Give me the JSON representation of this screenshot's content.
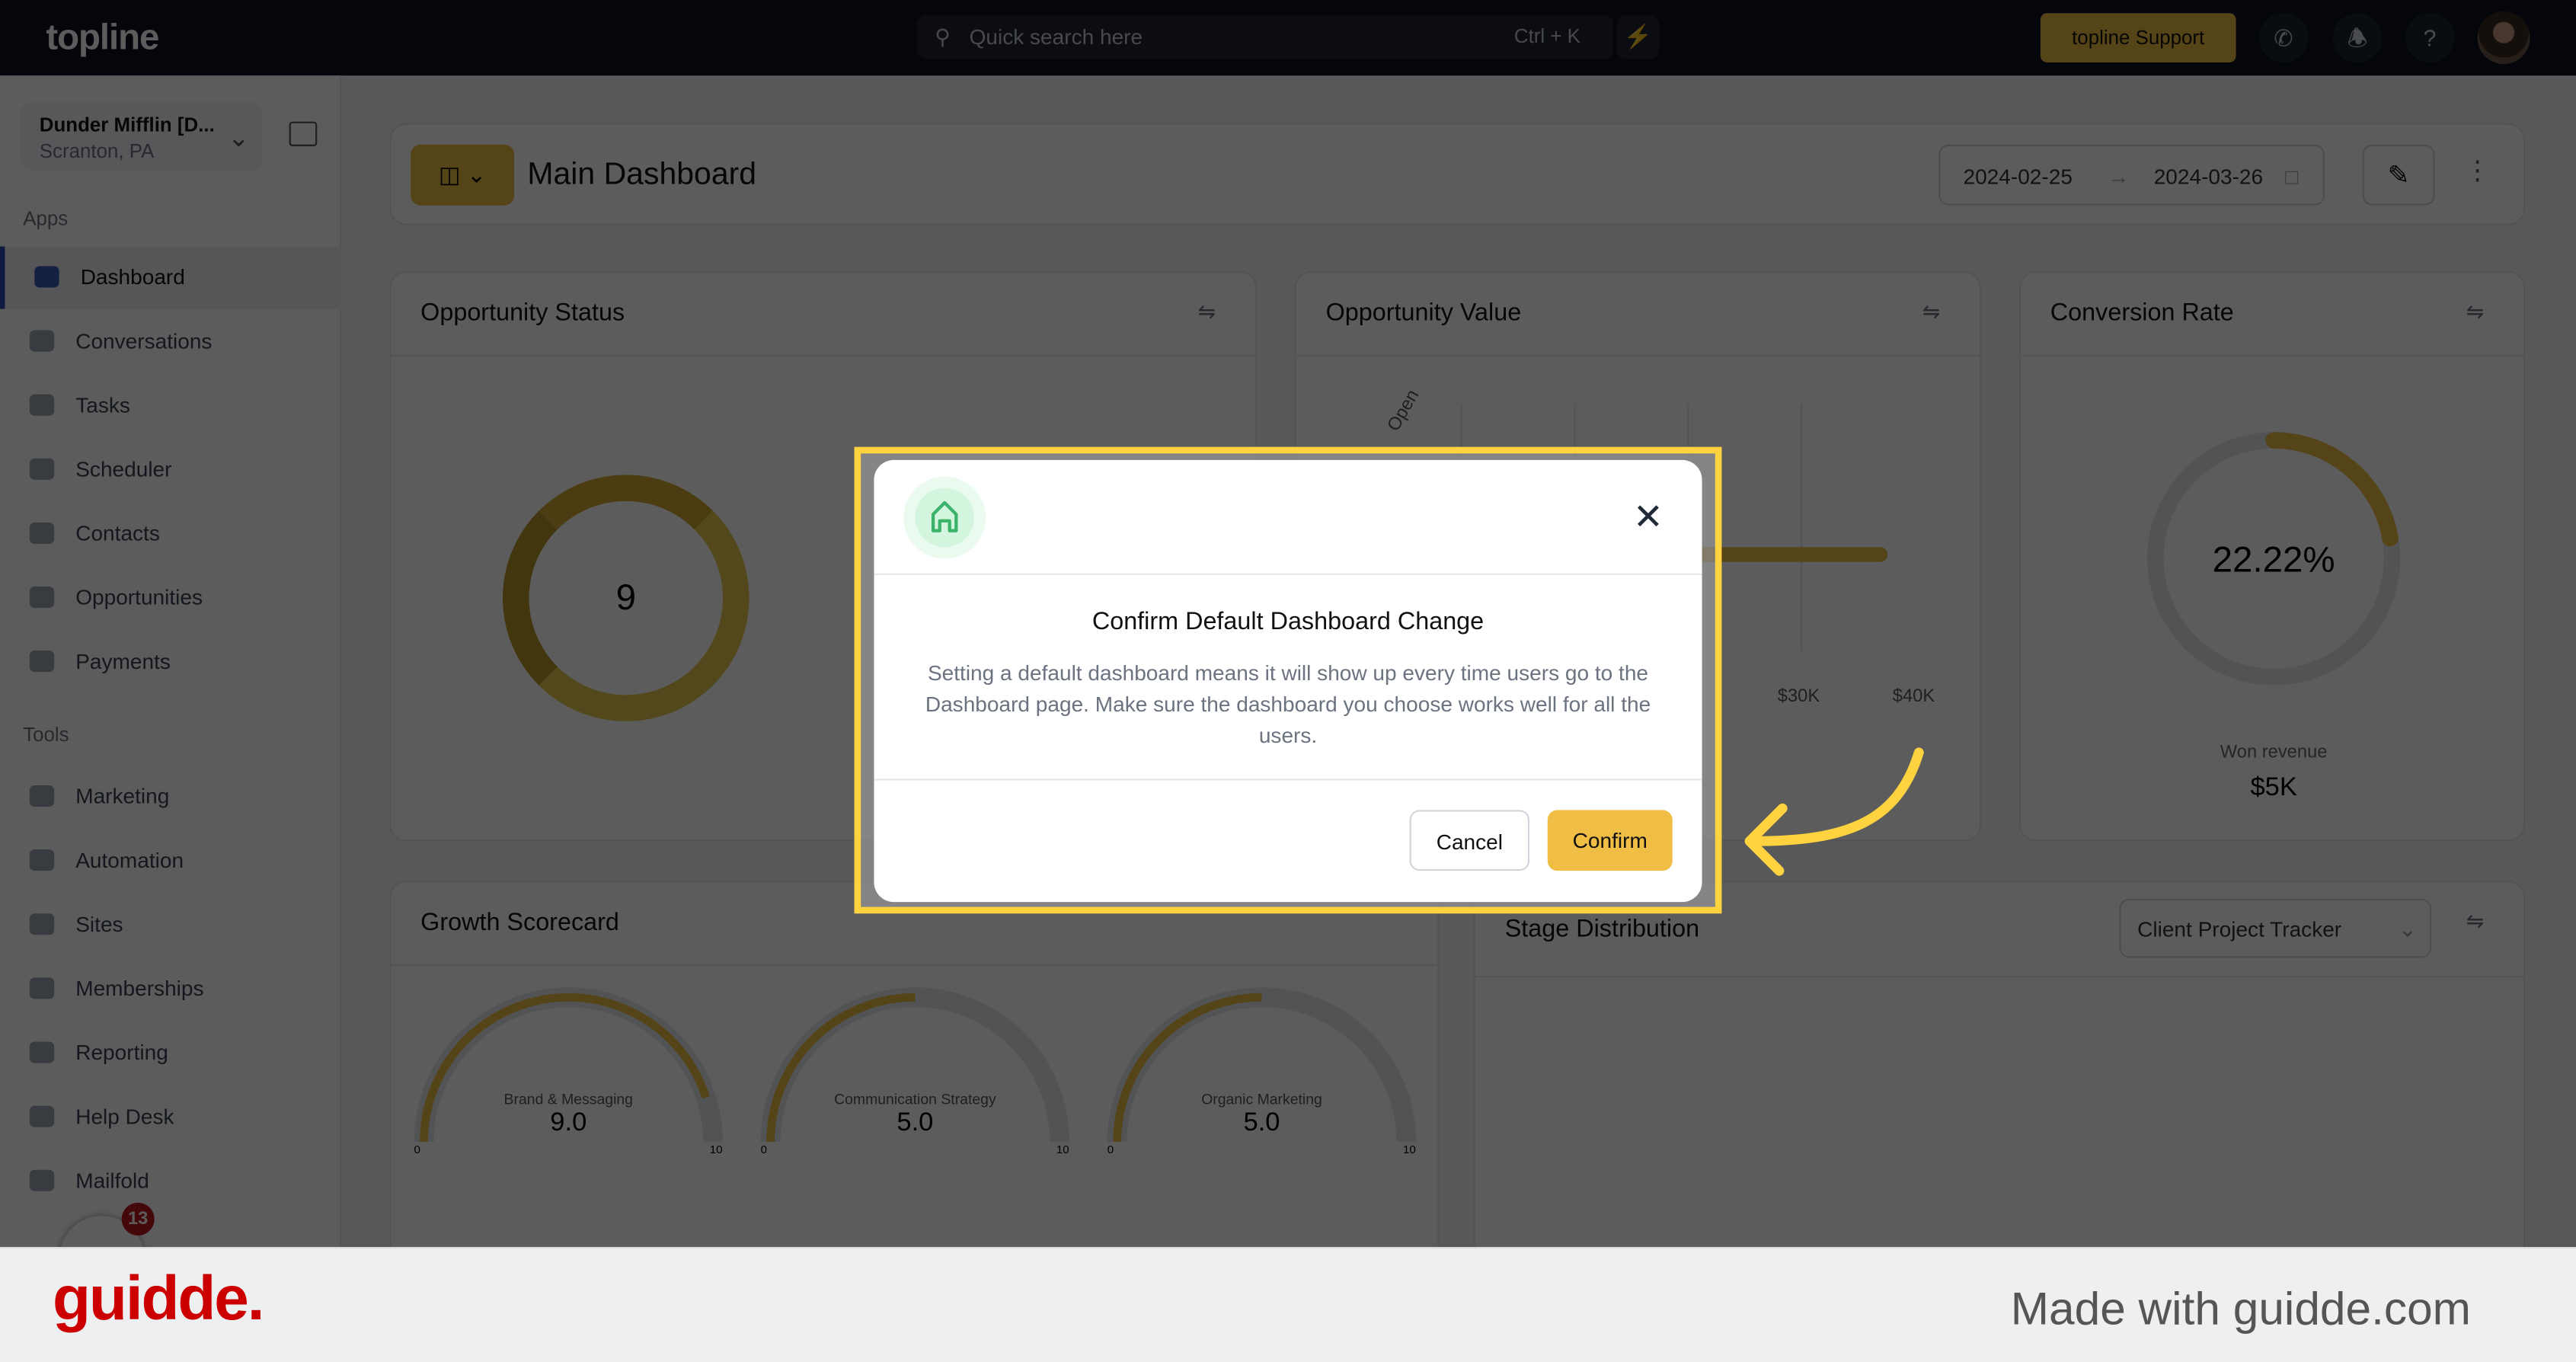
{
  "topbar": {
    "logo": "topline",
    "search_placeholder": "Quick search here",
    "search_shortcut": "Ctrl + K",
    "support_label": "topline Support",
    "icons": [
      "search-icon",
      "bolt-icon",
      "phone-icon",
      "bell-icon",
      "help-icon",
      "avatar"
    ]
  },
  "sidebar": {
    "account_name": "Dunder Mifflin [D...",
    "account_location": "Scranton, PA",
    "apps_label": "Apps",
    "apps": [
      {
        "label": "Dashboard",
        "active": true
      },
      {
        "label": "Conversations"
      },
      {
        "label": "Tasks"
      },
      {
        "label": "Scheduler"
      },
      {
        "label": "Contacts"
      },
      {
        "label": "Opportunities"
      },
      {
        "label": "Payments"
      }
    ],
    "tools_label": "Tools",
    "tools": [
      {
        "label": "Marketing"
      },
      {
        "label": "Automation"
      },
      {
        "label": "Sites"
      },
      {
        "label": "Memberships"
      },
      {
        "label": "Reporting"
      },
      {
        "label": "Help Desk"
      },
      {
        "label": "Mailfold"
      }
    ],
    "badge_count": "13"
  },
  "header": {
    "title": "Main Dashboard",
    "date_start": "2024-02-25",
    "date_end": "2024-03-26"
  },
  "widgets": {
    "opportunity_status": {
      "title": "Opportunity Status",
      "total": "9"
    },
    "opportunity_value": {
      "title": "Opportunity Value",
      "axis_label": "Open",
      "ticks": [
        "$30K",
        "$40K"
      ]
    },
    "conversion_rate": {
      "title": "Conversion Rate",
      "value": "22.22%",
      "fraction": 0.2222,
      "sub_label": "Won revenue",
      "sub_value": "$5K"
    },
    "growth_scorecard": {
      "title": "Growth Scorecard",
      "gauges": [
        {
          "label": "Brand & Messaging",
          "value": "9.0",
          "min": "0",
          "max": "10"
        },
        {
          "label": "Communication Strategy",
          "value": "5.0",
          "min": "0",
          "max": "10"
        },
        {
          "label": "Organic Marketing",
          "value": "5.0",
          "min": "0",
          "max": "10"
        }
      ]
    },
    "stage_distribution": {
      "title": "Stage Distribution",
      "pipeline": "Client Project Tracker"
    }
  },
  "modal": {
    "title": "Confirm Default Dashboard Change",
    "body": "Setting a default dashboard means it will show up every time users go to the Dashboard page. Make sure the dashboard you choose works well for all the users.",
    "cancel": "Cancel",
    "confirm": "Confirm",
    "icon": "home-icon"
  },
  "footer": {
    "logo": "guidde.",
    "tagline": "Made with guidde.com"
  },
  "colors": {
    "accent": "#f0bd45",
    "highlight": "#ffd23f",
    "brand_red": "#cc0000"
  }
}
